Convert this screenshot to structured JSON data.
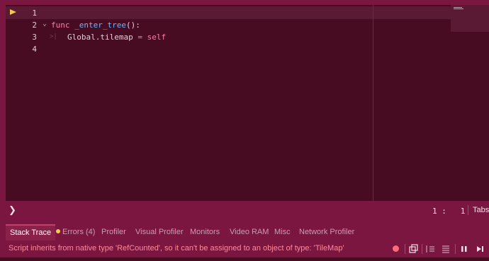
{
  "editor": {
    "lines": [
      {
        "number": "1",
        "tokens": []
      },
      {
        "number": "2",
        "tokens": [
          {
            "text": "func",
            "kind": "kw"
          },
          {
            "text": " ",
            "kind": "punc"
          },
          {
            "text": "_enter_tree",
            "kind": "fn"
          },
          {
            "text": "():",
            "kind": "punc"
          }
        ]
      },
      {
        "number": "3",
        "tokens": [
          {
            "text": "Global",
            "kind": "ident"
          },
          {
            "text": ".tilemap ",
            "kind": "ident"
          },
          {
            "text": "=",
            "kind": "kw"
          },
          {
            "text": " self",
            "kind": "kw"
          }
        ]
      },
      {
        "number": "4",
        "tokens": []
      }
    ],
    "fold_icon": "chevron-down-icon",
    "exec_marker_icon": "current-line-arrow-icon"
  },
  "status": {
    "toggle_icon": "chevron-right-icon",
    "toggle_glyph": "❯",
    "cursor_position": "1 :   1",
    "indent_mode": "Tabs"
  },
  "bottom_tabs": [
    {
      "label": "Stack Trace",
      "active": true
    },
    {
      "label": "Errors (4)",
      "active": false,
      "warning": true
    },
    {
      "label": "Profiler",
      "active": false
    },
    {
      "label": "Visual Profiler",
      "active": false
    },
    {
      "label": "Monitors",
      "active": false
    },
    {
      "label": "Video RAM",
      "active": false
    },
    {
      "label": "Misc",
      "active": false
    },
    {
      "label": "Network Profiler",
      "active": false
    }
  ],
  "message": "Script inherits from native type 'RefCounted', so it can't be assigned to an object of type: 'TileMap'",
  "colors": {
    "background": "#7b1640",
    "editor_background": "#470b22",
    "keyword": "#ff7aa8",
    "function": "#66b7ff",
    "error_text": "#ff8a9a",
    "warning_dot": "#f2c94c"
  }
}
